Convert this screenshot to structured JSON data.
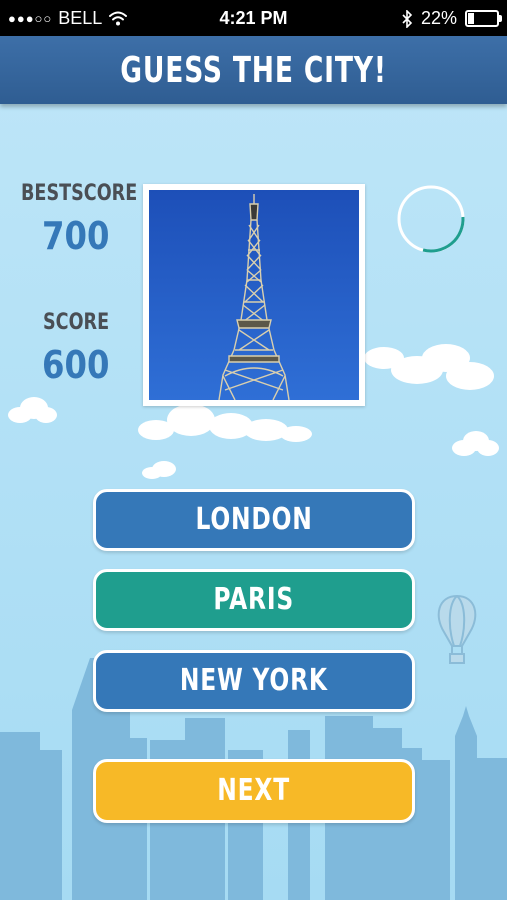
{
  "status_bar": {
    "carrier": "BELL",
    "time": "4:21 PM",
    "battery": "22%",
    "battery_level": 0.22,
    "icons": [
      "signal-dots-icon",
      "wifi-icon",
      "bluetooth-icon",
      "battery-icon"
    ]
  },
  "header": {
    "title": "GUESS THE CITY!"
  },
  "scores": {
    "best_label": "BESTSCORE",
    "best_value": "700",
    "score_label": "SCORE",
    "score_value": "600"
  },
  "timer": {
    "progress": 0.3,
    "icon": "timer-ring-icon"
  },
  "question": {
    "image": "eiffel-tower-photo"
  },
  "answers": [
    {
      "label": "LONDON",
      "color": "#3578b8"
    },
    {
      "label": "PARIS",
      "color": "#1f9e8e"
    },
    {
      "label": "NEW YORK",
      "color": "#3578b8"
    }
  ],
  "next": {
    "label": "NEXT",
    "color": "#f7b927"
  },
  "colors": {
    "header": "#3163a0",
    "sky": "#b3e1f6",
    "skyline": "#7fb9dc",
    "score_value": "#3578b8",
    "label": "#4a4f55"
  }
}
